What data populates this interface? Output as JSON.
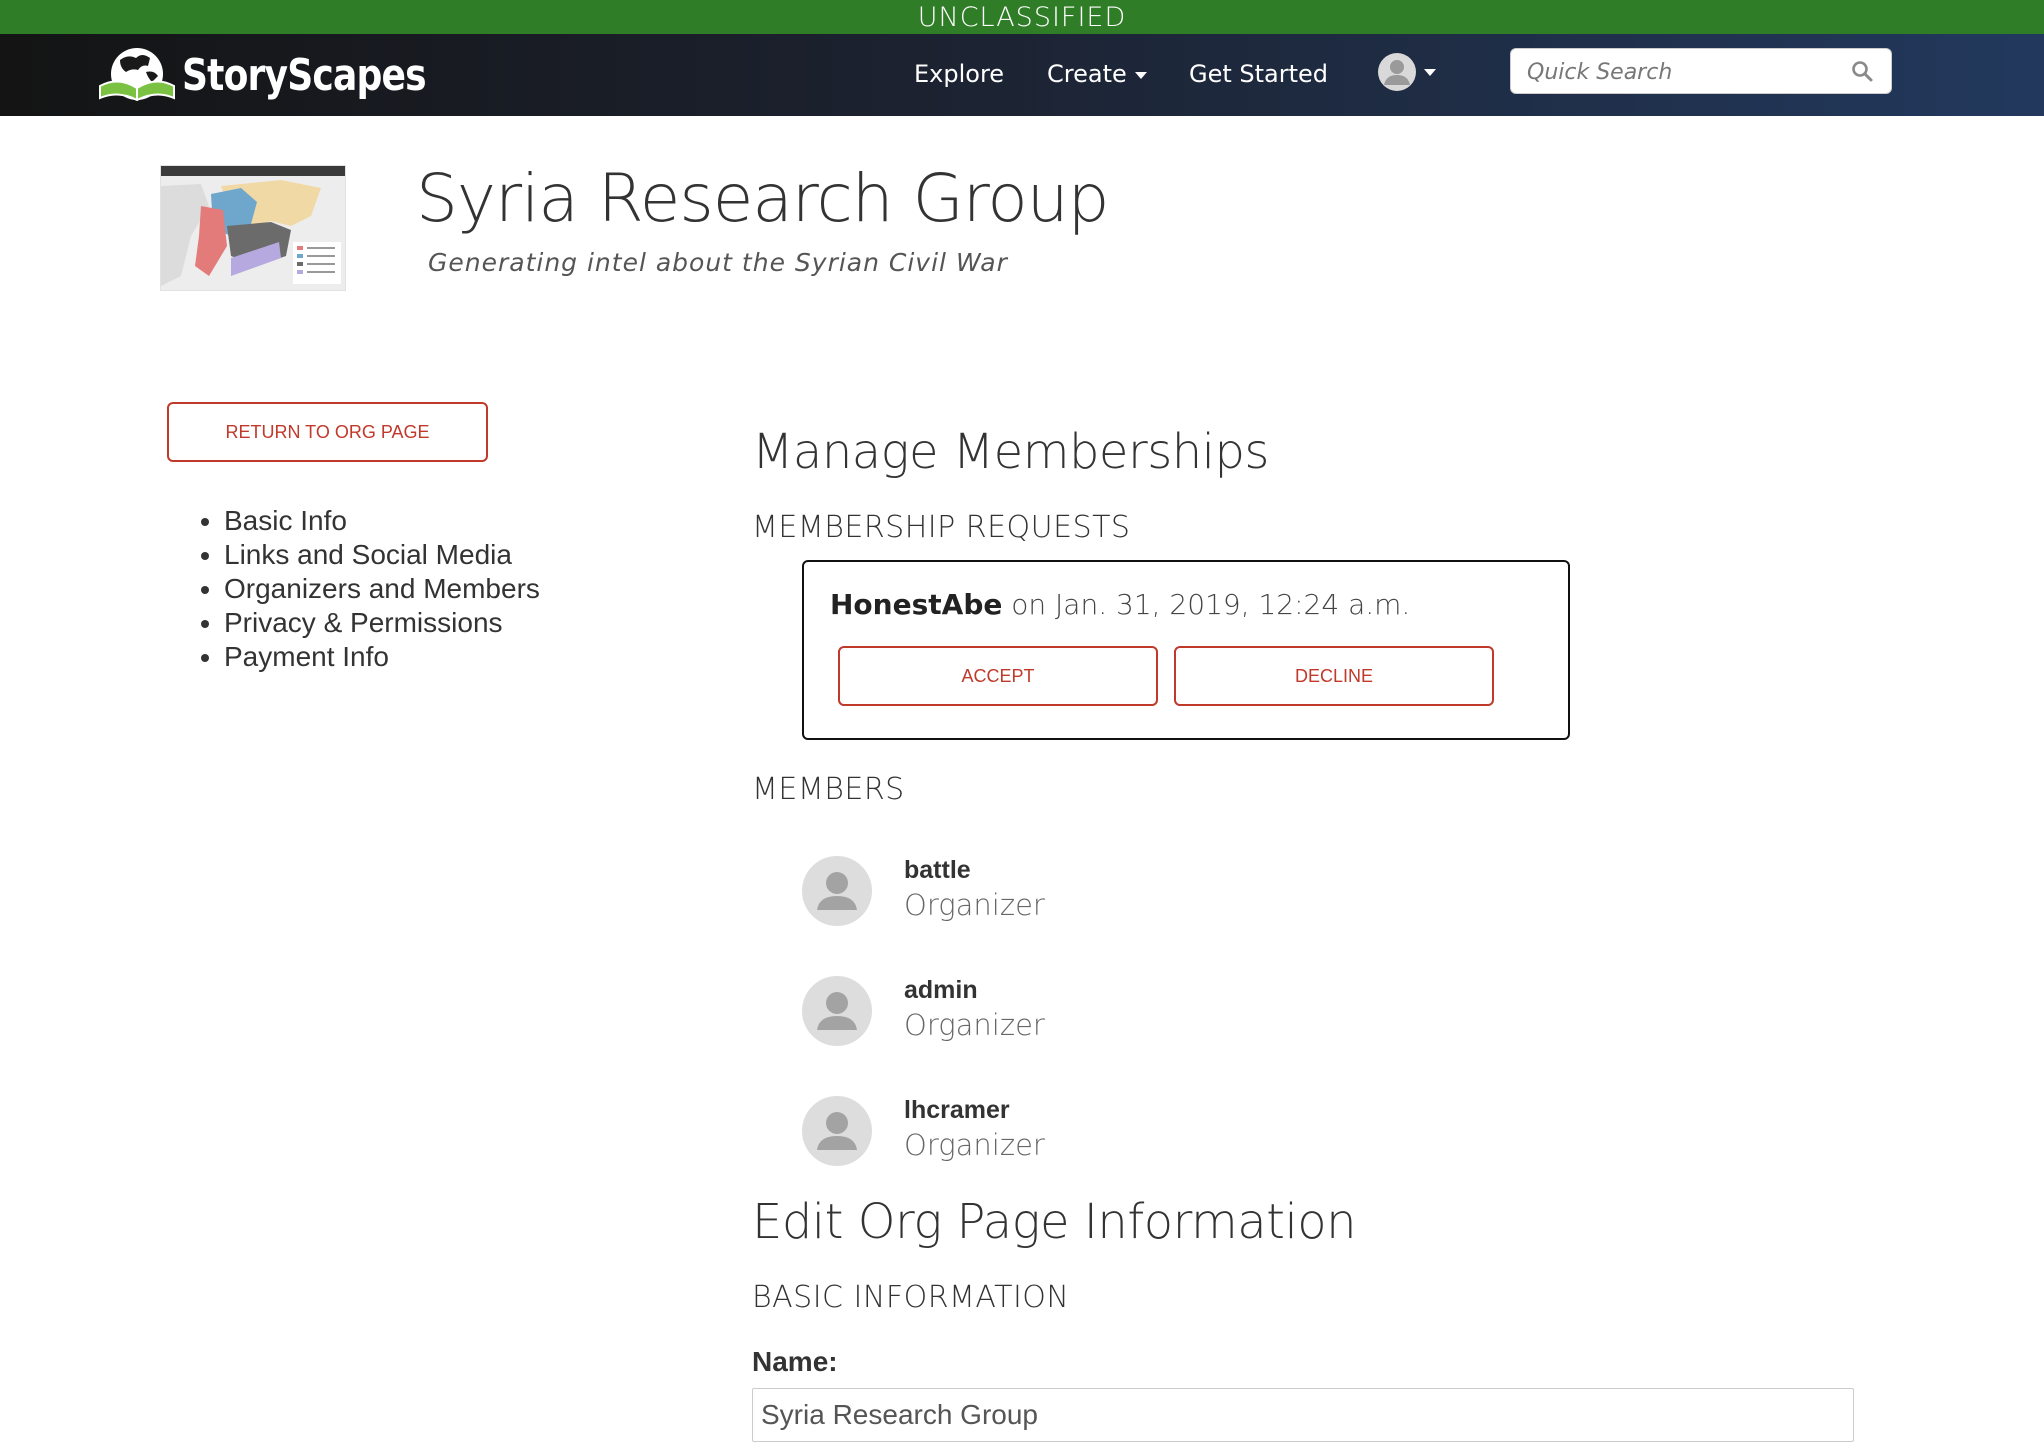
{
  "classification_banner": "UNCLASSIFIED",
  "brand": {
    "name": "StoryScapes"
  },
  "nav": {
    "explore": "Explore",
    "create": "Create",
    "get_started": "Get Started"
  },
  "search": {
    "placeholder": "Quick Search"
  },
  "org": {
    "title": "Syria Research Group",
    "subtitle": "Generating intel about the Syrian Civil War"
  },
  "sidebar": {
    "return_label": "RETURN TO ORG PAGE",
    "items": [
      {
        "label": "Basic Info"
      },
      {
        "label": "Links and Social Media"
      },
      {
        "label": "Organizers and Members"
      },
      {
        "label": "Privacy & Permissions"
      },
      {
        "label": "Payment Info"
      }
    ]
  },
  "memberships": {
    "heading": "Manage Memberships",
    "requests_heading": "MEMBERSHIP REQUESTS",
    "request": {
      "user": "HonestAbe",
      "date_text": "on Jan. 31, 2019, 12:24 a.m.",
      "accept_label": "ACCEPT",
      "decline_label": "DECLINE"
    },
    "members_heading": "MEMBERS",
    "members": [
      {
        "name": "battle",
        "role": "Organizer"
      },
      {
        "name": "admin",
        "role": "Organizer"
      },
      {
        "name": "lhcramer",
        "role": "Organizer"
      }
    ]
  },
  "edit": {
    "heading": "Edit Org Page Information",
    "basic_heading": "BASIC INFORMATION",
    "name_label": "Name:",
    "name_value": "Syria Research Group"
  },
  "colors": {
    "banner_green": "#2f7d27",
    "accent_red": "#c0392b",
    "nav_dark": "#141414",
    "nav_blue": "#22395d"
  }
}
